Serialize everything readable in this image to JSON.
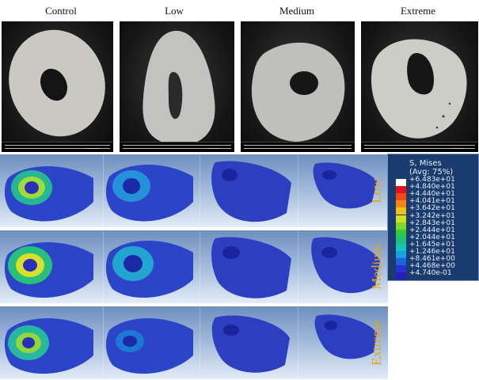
{
  "columns": [
    {
      "title": "Control"
    },
    {
      "title": "Low"
    },
    {
      "title": "Medium"
    },
    {
      "title": "Extreme"
    }
  ],
  "rows": [
    {
      "label": "Low"
    },
    {
      "label": "Medium"
    },
    {
      "label": "Extreme"
    }
  ],
  "legend": {
    "title": "S, Mises",
    "subtitle": "(Avg: 75%)",
    "entries": [
      {
        "value": "+6.483e+01",
        "color": "#ffffff"
      },
      {
        "value": "+4.840e+01",
        "color": "#e0141e"
      },
      {
        "value": "+4.440e+01",
        "color": "#ee4a15"
      },
      {
        "value": "+4.041e+01",
        "color": "#f5841a"
      },
      {
        "value": "+3.642e+01",
        "color": "#f2c21c"
      },
      {
        "value": "+3.242e+01",
        "color": "#cfe21f"
      },
      {
        "value": "+2.843e+01",
        "color": "#7fd82a"
      },
      {
        "value": "+2.444e+01",
        "color": "#33c93a"
      },
      {
        "value": "+2.044e+01",
        "color": "#1fc07a"
      },
      {
        "value": "+1.645e+01",
        "color": "#17c2b6"
      },
      {
        "value": "+1.246e+01",
        "color": "#16a2e0"
      },
      {
        "value": "+8.461e+00",
        "color": "#1d62e2"
      },
      {
        "value": "+4.468e+00",
        "color": "#2731d4"
      },
      {
        "value": "+4.740e-01",
        "color": "#2a1bbd"
      }
    ]
  }
}
